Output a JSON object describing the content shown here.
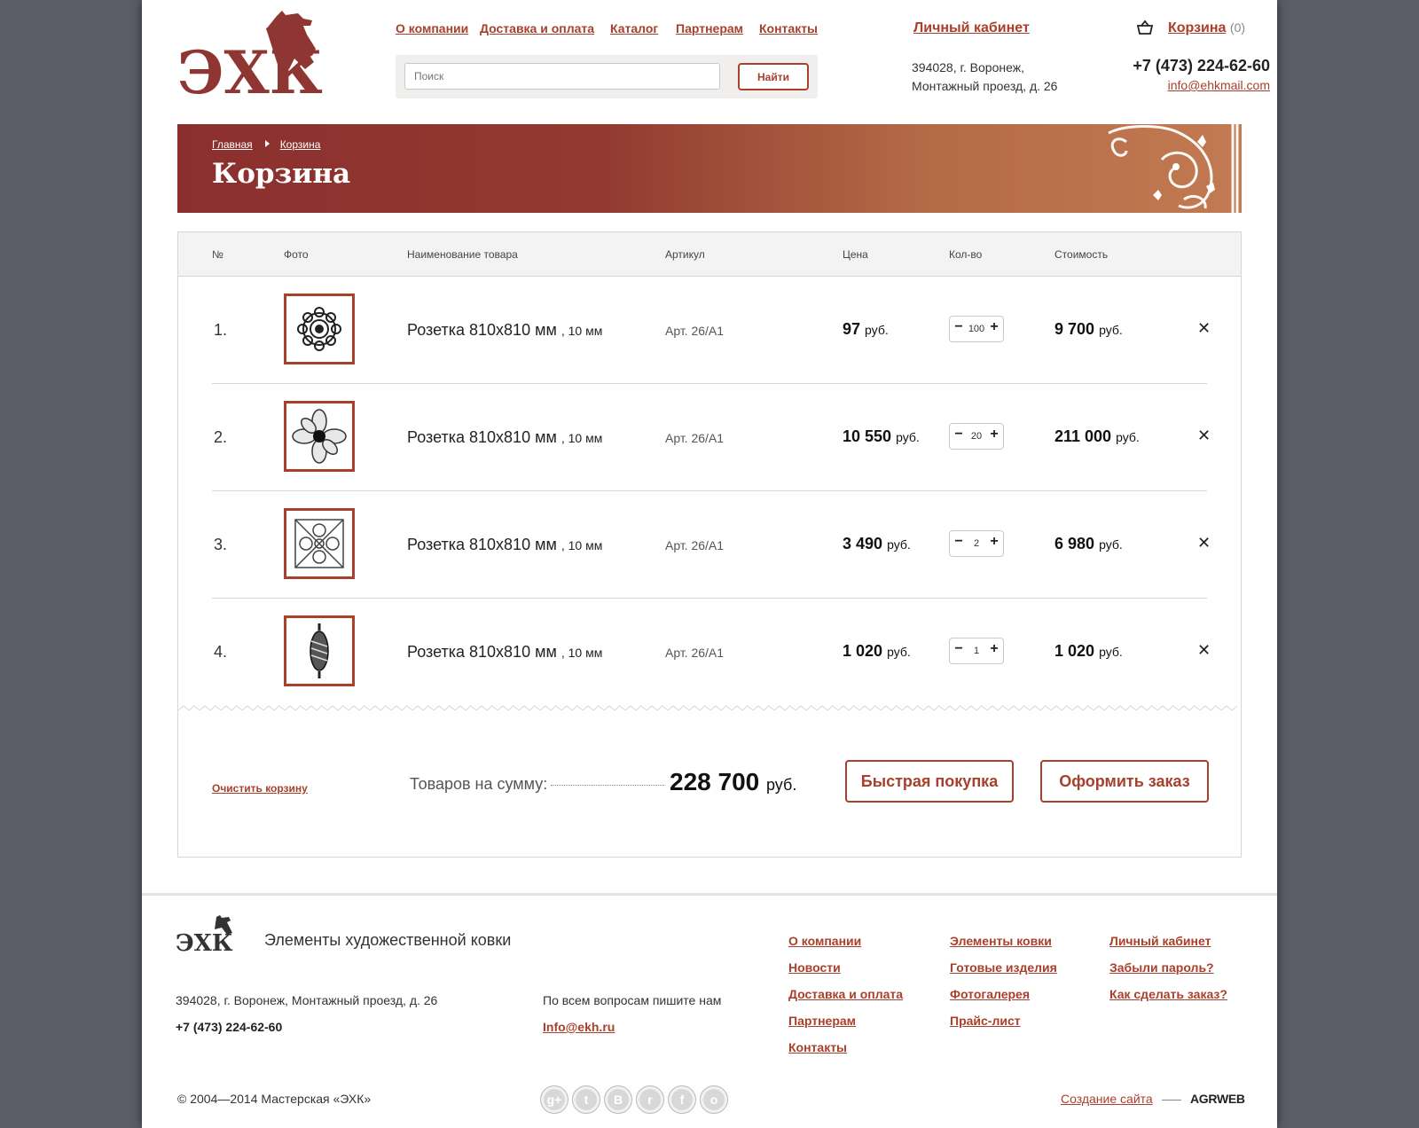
{
  "header": {
    "nav": [
      "О компании",
      "Доставка и оплата",
      "Каталог",
      "Партнерам",
      "Контакты"
    ],
    "search_placeholder": "Поиск",
    "search_button": "Найти",
    "cabinet": "Личный кабинет",
    "address_line1": "394028, г. Воронеж,",
    "address_line2": "Монтажный проезд, д. 26",
    "cart_label": "Корзина",
    "cart_count": "(0)",
    "phone": "+7 (473) 224-62-60",
    "email": "info@ehkmail.com",
    "logo_text": "ЭХК"
  },
  "banner": {
    "crumb_home": "Главная",
    "crumb_current": "Корзина",
    "title": "Корзина"
  },
  "table": {
    "headers": [
      "№",
      "Фото",
      "Наименование товара",
      "Артикул",
      "Цена",
      "Кол-во",
      "Стоимость"
    ],
    "currency": "руб.",
    "rows": [
      {
        "num": "1.",
        "name": "Розетка 810х810 мм",
        "size": ", 10 мм",
        "article": "Арт. 26/А1",
        "price": "97",
        "qty": "100",
        "cost": "9 700",
        "icon": "rosette-round-icon"
      },
      {
        "num": "2.",
        "name": "Розетка 810х810 мм",
        "size": ", 10 мм",
        "article": "Арт. 26/А1",
        "price": "10 550",
        "qty": "20",
        "cost": "211 000",
        "icon": "flower-icon"
      },
      {
        "num": "3.",
        "name": "Розетка 810х810 мм",
        "size": ", 10 мм",
        "article": "Арт. 26/А1",
        "price": "3 490",
        "qty": "2",
        "cost": "6 980",
        "icon": "scroll-square-icon"
      },
      {
        "num": "4.",
        "name": "Розетка 810х810 мм",
        "size": ", 10 мм",
        "article": "Арт. 26/А1",
        "price": "1 020",
        "qty": "1",
        "cost": "1 020",
        "icon": "twisted-bar-icon"
      }
    ]
  },
  "summary": {
    "clear": "Очистить корзину",
    "label": "Товаров на сумму:",
    "total": "228 700",
    "currency": "руб.",
    "quick_buy": "Быстрая покупка",
    "checkout": "Оформить заказ"
  },
  "footer": {
    "slogan": "Элементы художественной ковки",
    "address": "394028, г. Воронеж, Монтажный проезд, д. 26",
    "phone": "+7 (473) 224-62-60",
    "ask": "По всем вопросам пишите нам",
    "mail": "Info@ekh.ru",
    "col1": [
      "О компании",
      "Новости",
      "Доставка и оплата",
      "Партнерам",
      "Контакты"
    ],
    "col2": [
      "Элементы ковки",
      "Готовые изделия",
      "Фотогалерея",
      "Прайс-лист"
    ],
    "col3": [
      "Личный кабинет",
      "Забыли пароль?",
      "Как сделать заказ?"
    ],
    "copyright": "© 2004—2014 Мастерская «ЭХК»",
    "social": [
      "google-plus-icon",
      "twitter-icon",
      "vk-icon",
      "rss-icon",
      "facebook-icon",
      "odnoklassniki-icon"
    ],
    "social_glyphs": [
      "g+",
      "t",
      "В",
      "r",
      "f",
      "о"
    ],
    "created": "Создание сайта",
    "agency": "AGRWEB"
  },
  "colors": {
    "accent": "#a8402c",
    "banner_start": "#8b2f2e",
    "banner_end": "#c27a52",
    "background": "#5b5e66"
  }
}
